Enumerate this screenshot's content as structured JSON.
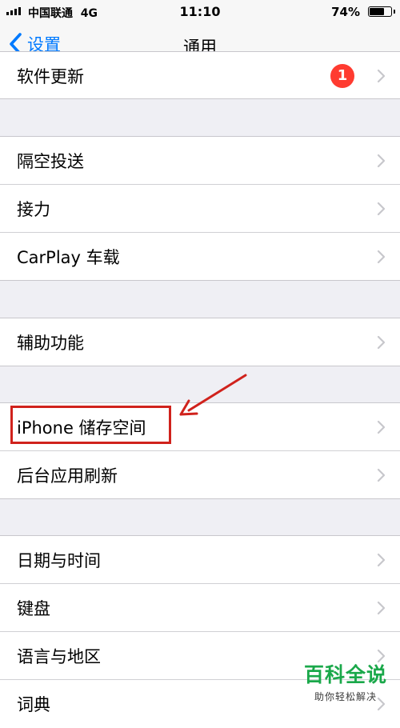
{
  "status_bar": {
    "carrier": "中国联通",
    "network": "4G",
    "time": "11:10",
    "battery": "74%",
    "battery_level": 0.74
  },
  "nav": {
    "back_label": "设置",
    "title": "通用"
  },
  "groups": [
    {
      "items": [
        {
          "label": "软件更新",
          "badge": "1"
        }
      ]
    },
    {
      "items": [
        {
          "label": "隔空投送"
        },
        {
          "label": "接力"
        },
        {
          "label": "CarPlay 车载"
        }
      ]
    },
    {
      "items": [
        {
          "label": "辅助功能"
        }
      ]
    },
    {
      "items": [
        {
          "label": "iPhone 储存空间"
        },
        {
          "label": "后台应用刷新"
        }
      ]
    },
    {
      "items": [
        {
          "label": "日期与时间"
        },
        {
          "label": "键盘"
        },
        {
          "label": "语言与地区"
        },
        {
          "label": "词典"
        }
      ]
    }
  ],
  "watermark": {
    "title": "百科全说",
    "subtitle": "助你轻松解决"
  },
  "colors": {
    "accent": "#007aff",
    "badge": "#ff3b30",
    "annotation": "#d0221c",
    "watermark": "#1aa84a"
  }
}
